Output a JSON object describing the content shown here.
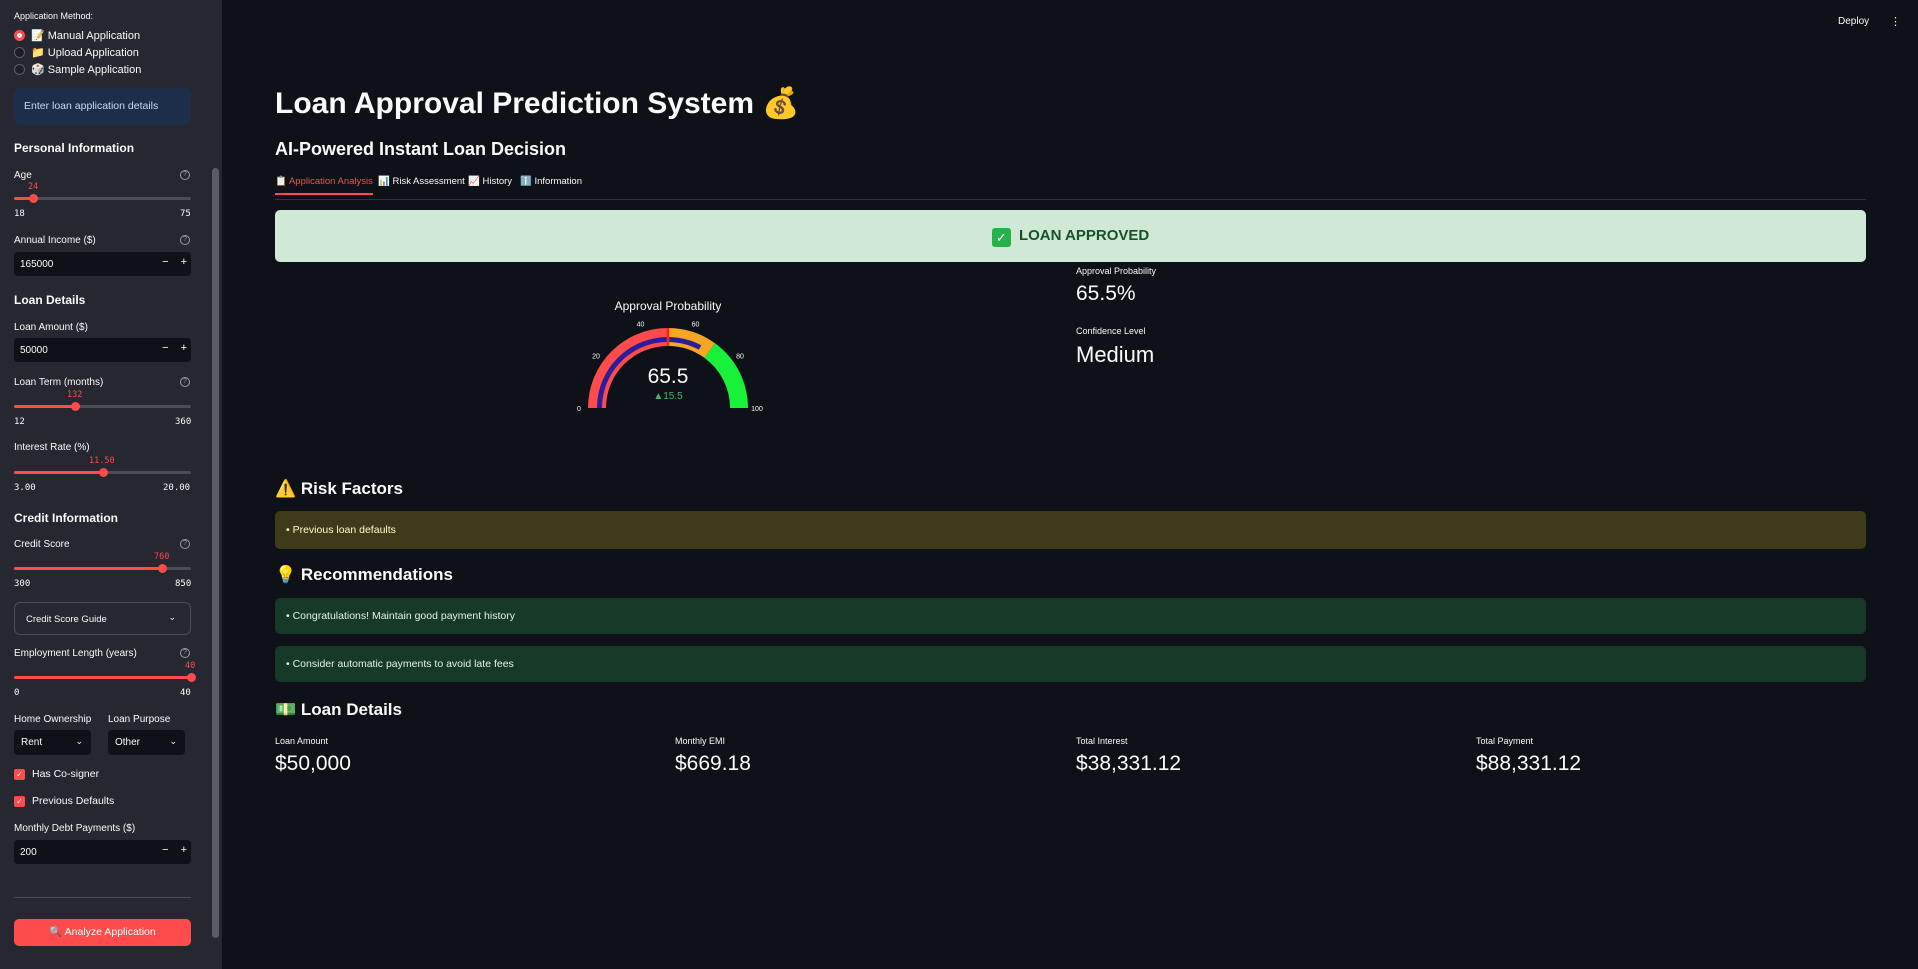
{
  "sidebar": {
    "method_label": "Application Method:",
    "methods": [
      "📝 Manual Application",
      "📁 Upload Application",
      "🎲 Sample Application"
    ],
    "info": "Enter loan application details",
    "personal": {
      "heading": "Personal Information",
      "age": {
        "label": "Age",
        "value": "24",
        "min": "18",
        "max": "75",
        "fraction": 0.107
      },
      "income": {
        "label": "Annual Income ($)",
        "value": "165000"
      }
    },
    "loan": {
      "heading": "Loan Details",
      "amount": {
        "label": "Loan Amount ($)",
        "value": "50000"
      },
      "term": {
        "label": "Loan Term (months)",
        "value": "132",
        "min": "12",
        "max": "360",
        "fraction": 0.345
      },
      "rate": {
        "label": "Interest Rate (%)",
        "value": "11.50",
        "min": "3.00",
        "max": "20.00",
        "fraction": 0.5
      }
    },
    "credit": {
      "heading": "Credit Information",
      "score": {
        "label": "Credit Score",
        "value": "760",
        "min": "300",
        "max": "850",
        "fraction": 0.836
      },
      "guide": "Credit Score Guide",
      "employment": {
        "label": "Employment Length (years)",
        "value": "40",
        "min": "0",
        "max": "40",
        "fraction": 1.0
      },
      "home_label": "Home Ownership",
      "home_value": "Rent",
      "purpose_label": "Loan Purpose",
      "purpose_value": "Other",
      "cosigner": "Has Co-signer",
      "defaults": "Previous Defaults",
      "debt": {
        "label": "Monthly Debt Payments ($)",
        "value": "200"
      }
    },
    "analyze": "🔍 Analyze Application"
  },
  "header": {
    "deploy": "Deploy",
    "menu_icon": "kebab-icon"
  },
  "main": {
    "title": "Loan Approval Prediction System 💰",
    "subtitle": "AI-Powered Instant Loan Decision",
    "tabs": [
      "📋 Application Analysis",
      "📊 Risk Assessment",
      "📈 History",
      "ℹ️ Information"
    ],
    "result": "LOAN APPROVED",
    "result_icon": "✓",
    "approval_label": "Approval Probability",
    "approval_value": "65.5%",
    "confidence_label": "Confidence Level",
    "confidence_value": "Medium",
    "risk_heading": "⚠️ Risk Factors",
    "risk_items": [
      "• Previous loan defaults"
    ],
    "rec_heading": "💡 Recommendations",
    "rec_items": [
      "• Congratulations! Maintain good payment history",
      "• Consider automatic payments to avoid late fees"
    ],
    "details_heading": "💵 Loan Details",
    "details": [
      {
        "label": "Loan Amount",
        "value": "$50,000"
      },
      {
        "label": "Monthly EMI",
        "value": "$669.18"
      },
      {
        "label": "Total Interest",
        "value": "$38,331.12"
      },
      {
        "label": "Total Payment",
        "value": "$88,331.12"
      }
    ]
  },
  "chart_data": {
    "type": "gauge",
    "title": "Approval Probability",
    "value": 65.5,
    "delta": "▲15.5",
    "range": [
      0,
      100
    ],
    "ticks": [
      "0",
      "20",
      "40",
      "60",
      "80",
      "100"
    ],
    "bands": [
      {
        "from": 0,
        "to": 50,
        "color": "#ff4b4b"
      },
      {
        "from": 50,
        "to": 70,
        "color": "#f5a623"
      },
      {
        "from": 70,
        "to": 100,
        "color": "#19f03a"
      }
    ],
    "bar_color": "#2a1e9b",
    "threshold": 50,
    "threshold_color": "#ff2020"
  }
}
